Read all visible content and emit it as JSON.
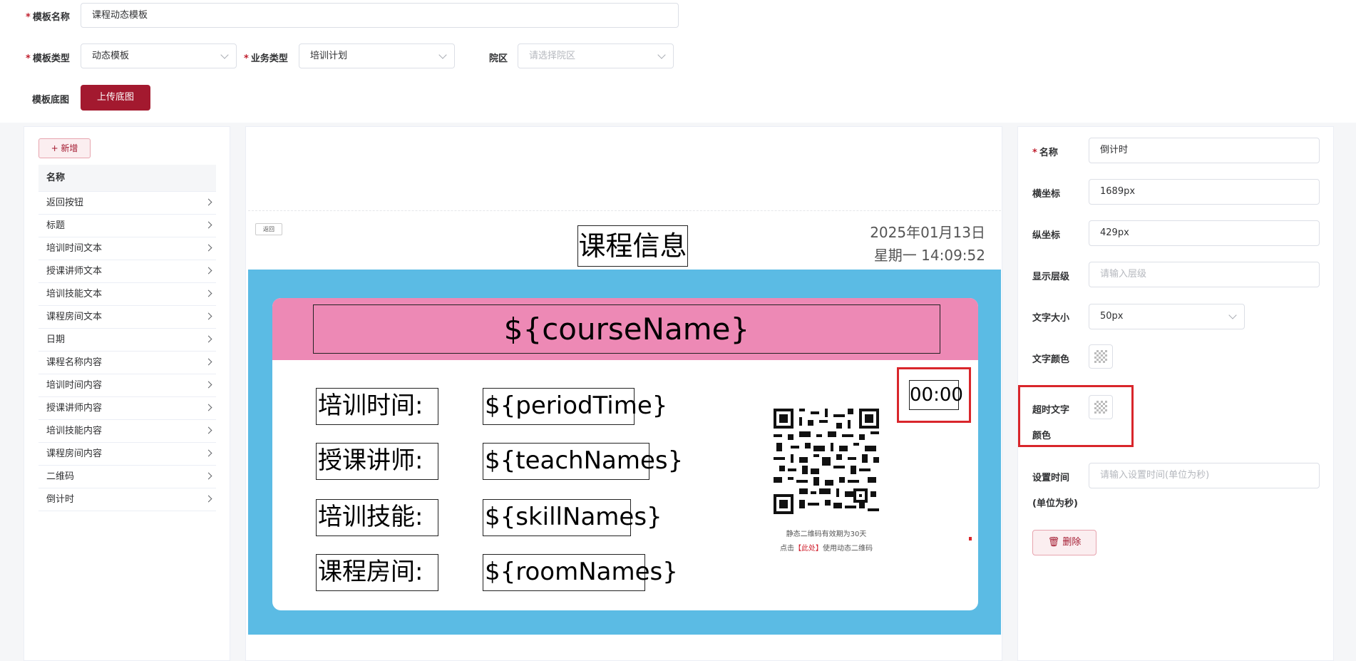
{
  "form": {
    "template_name_label": "模板名称",
    "template_name_value": "课程动态模板",
    "template_type_label": "模板类型",
    "template_type_value": "动态模板",
    "business_type_label": "业务类型",
    "business_type_value": "培训计划",
    "campus_label": "院区",
    "campus_placeholder": "请选择院区",
    "base_image_label": "模板底图",
    "upload_button": "上传底图"
  },
  "left": {
    "add_button": "+ 新增",
    "column_header": "名称",
    "items": [
      "返回按钮",
      "标题",
      "培训时间文本",
      "授课讲师文本",
      "培训技能文本",
      "课程房间文本",
      "日期",
      "课程名称内容",
      "培训时间内容",
      "授课讲师内容",
      "培训技能内容",
      "课程房间内容",
      "二维码",
      "倒计时"
    ]
  },
  "canvas": {
    "back_button": "返回",
    "title": "课程信息",
    "date_line1": "2025年01月13日",
    "date_line2": "星期一 14:09:52",
    "course_name": "${courseName}",
    "labels": [
      "培训时间:",
      "授课讲师:",
      "培训技能:",
      "课程房间:"
    ],
    "values": [
      "${periodTime}",
      "${teachNames}",
      "${skillNames}",
      "${roomNames}"
    ],
    "qr_note1": "静态二维码有效期为30天",
    "qr_note2_prefix": "点击",
    "qr_note2_link": "【此处】",
    "qr_note2_suffix": "使用动态二维码",
    "timer": "00:00"
  },
  "props": {
    "name_label": "名称",
    "name_value": "倒计时",
    "x_label": "横坐标",
    "x_value": "1689px",
    "y_label": "纵坐标",
    "y_value": "429px",
    "layer_label": "显示层级",
    "layer_placeholder": "请输入层级",
    "font_size_label": "文字大小",
    "font_size_value": "50px",
    "text_color_label": "文字颜色",
    "timeout_color_label_1": "超时文字",
    "timeout_color_label_2": "颜色",
    "set_time_label_1": "设置时间",
    "set_time_label_2": "(单位为秒)",
    "set_time_placeholder": "请输入设置时间(单位为秒)",
    "delete_button": "删除"
  },
  "colors": {
    "primary": "#a3192f",
    "canvas_blue": "#5bbbe4",
    "canvas_pink": "#ed89b5",
    "highlight_red": "#d9262b"
  }
}
